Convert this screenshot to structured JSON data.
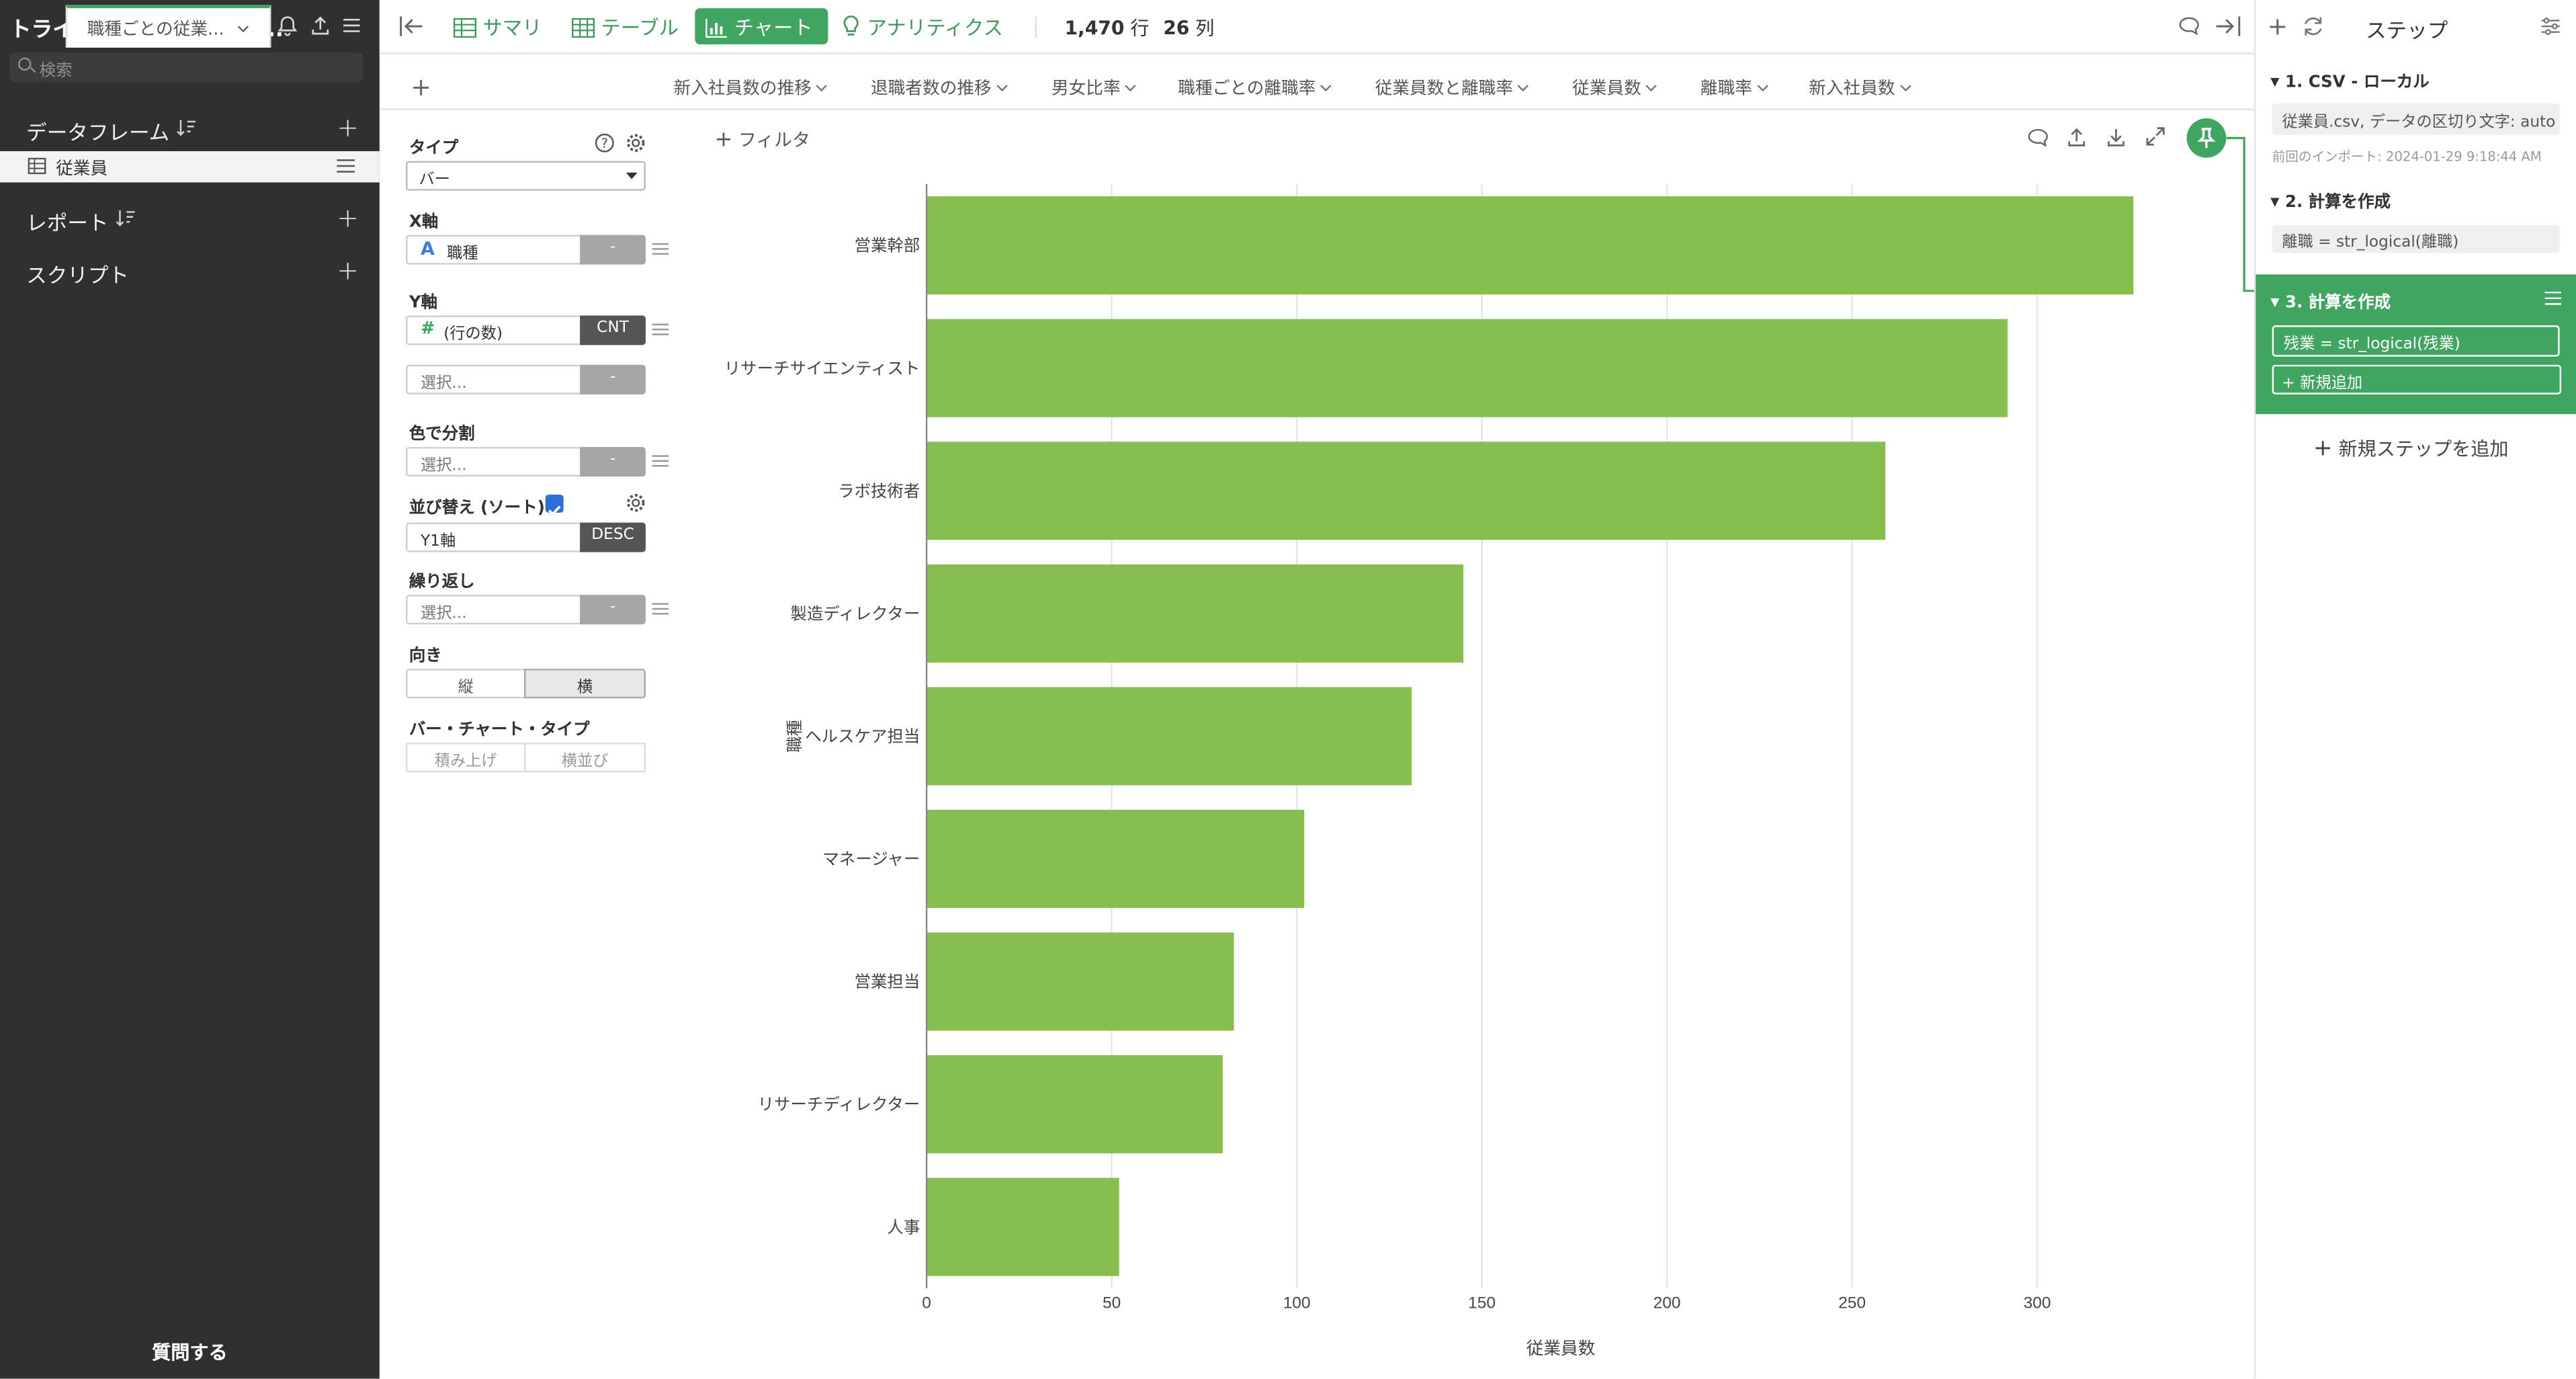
{
  "app": {
    "title": "トライアルツアー Part 5..."
  },
  "sidebar": {
    "search_placeholder": "検索",
    "dataframes_label": "データフレーム",
    "dataframe_items": [
      {
        "label": "従業員"
      }
    ],
    "reports_label": "レポート",
    "scripts_label": "スクリプト",
    "ask_label": "質問する"
  },
  "toolbar": {
    "summary_label": "サマリ",
    "table_label": "テーブル",
    "chart_label": "チャート",
    "analytics_label": "アナリティクス",
    "rows_value": "1,470",
    "rows_unit": "行",
    "cols_value": "26",
    "cols_unit": "列"
  },
  "tabs": [
    {
      "label": "職種ごとの従業..."
    },
    {
      "label": "新入社員数の推移"
    },
    {
      "label": "退職者数の推移"
    },
    {
      "label": "男女比率"
    },
    {
      "label": "職種ごとの離職率"
    },
    {
      "label": "従業員数と離職率"
    },
    {
      "label": "従業員数"
    },
    {
      "label": "離職率"
    },
    {
      "label": "新入社員数"
    }
  ],
  "config": {
    "type_label": "タイプ",
    "type_value": "バー",
    "x_label": "X軸",
    "x_value": "職種",
    "x_tag": "-",
    "y_label": "Y軸",
    "y_value": "(行の数)",
    "y_tag": "CNT",
    "y2_placeholder": "選択...",
    "y2_tag": "-",
    "color_label": "色で分割",
    "color_placeholder": "選択...",
    "color_tag": "-",
    "sort_label": "並び替え (ソート)",
    "sort_checked": true,
    "sort_value": "Y1軸",
    "sort_tag": "DESC",
    "repeat_label": "繰り返し",
    "repeat_placeholder": "選択...",
    "repeat_tag": "-",
    "orientation_label": "向き",
    "orientation_vertical": "縦",
    "orientation_horizontal": "横",
    "orientation_selected": "横",
    "bar_type_label": "バー・チャート・タイプ",
    "bar_type_stacked": "積み上げ",
    "bar_type_side": "横並び"
  },
  "chart_area": {
    "filter_label": "フィルタ"
  },
  "chart_data": {
    "type": "bar",
    "orientation": "horizontal",
    "categories": [
      "営業幹部",
      "リサーチサイエンティスト",
      "ラボ技術者",
      "製造ディレクター",
      "ヘルスケア担当",
      "マネージャー",
      "営業担当",
      "リサーチディレクター",
      "人事"
    ],
    "values": [
      326,
      292,
      259,
      145,
      131,
      102,
      83,
      80,
      52
    ],
    "xlabel": "従業員数",
    "ylabel": "職種",
    "xlim": [
      0,
      350
    ],
    "xticks": [
      0,
      50,
      100,
      150,
      200,
      250,
      300
    ],
    "grid": true,
    "bar_color": "#86bf50"
  },
  "steps": {
    "title": "ステップ",
    "add_step_label": "新規ステップを追加",
    "items": [
      {
        "header": "1. CSV - ローカル",
        "content": "従業員.csv, データの区切り文字: auto",
        "note": "前回のインポート: 2024-01-29 9:18:44 AM"
      },
      {
        "header": "2. 計算を作成",
        "content": "離職 = str_logical(離職)"
      },
      {
        "header": "3. 計算を作成",
        "content": "残業 = str_logical(残業)",
        "add_label": "新規追加"
      }
    ]
  },
  "colors": {
    "accent": "#3fa561",
    "sidebar_bg": "#2f3131",
    "bar": "#86bf50"
  }
}
